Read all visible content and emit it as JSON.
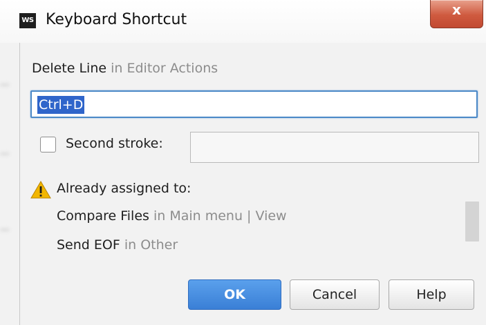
{
  "window": {
    "title": "Keyboard Shortcut",
    "app_icon_text": "WS",
    "close_glyph": "x"
  },
  "action": {
    "name": "Delete Line",
    "context": "in Editor Actions"
  },
  "shortcut": {
    "value": "Ctrl+D"
  },
  "second_stroke": {
    "label": "Second stroke:",
    "checked": false,
    "value": ""
  },
  "conflicts": {
    "heading": "Already assigned to:",
    "icon": "warning-icon",
    "items": [
      {
        "name": "Compare Files",
        "context": "in Main menu | View"
      },
      {
        "name": "Send EOF",
        "context": "in Other"
      }
    ]
  },
  "buttons": {
    "ok": "OK",
    "cancel": "Cancel",
    "help": "Help"
  },
  "colors": {
    "accent": "#3a7fd6",
    "selection": "#2f65ca",
    "context_text": "#8c8c8c",
    "close_button": "#cf5a3f",
    "warning": "#f2b600"
  }
}
